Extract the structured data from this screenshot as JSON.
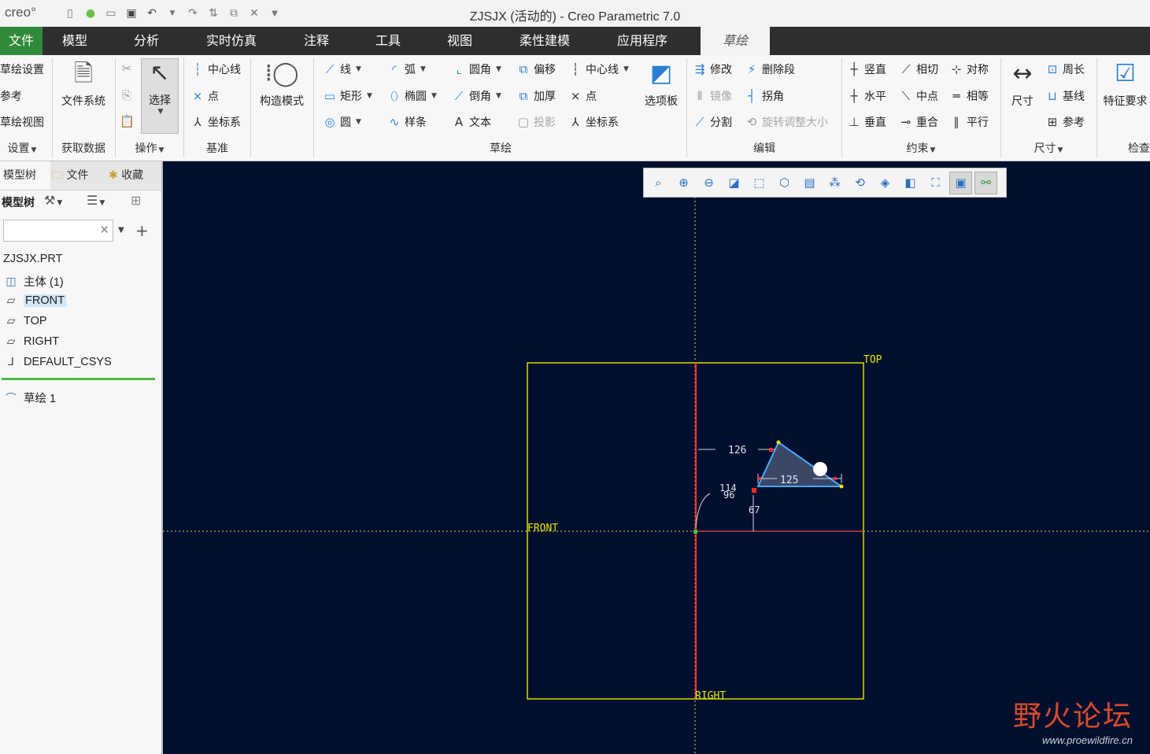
{
  "app": {
    "logo": "creo°",
    "window_title": "ZJSJX (活动的) - Creo Parametric 7.0"
  },
  "tabs": [
    "文件",
    "模型",
    "分析",
    "实时仿真",
    "注释",
    "工具",
    "视图",
    "柔性建模",
    "应用程序",
    "草绘"
  ],
  "ribbon": {
    "setup": {
      "items": [
        "草绘设置",
        "参考",
        "草绘视图"
      ],
      "group": "设置"
    },
    "get_data": {
      "button": "文件系统",
      "group": "获取数据"
    },
    "operations": {
      "button": "选择",
      "group": "操作"
    },
    "datum": {
      "items": [
        "中心线",
        "点",
        "坐标系"
      ],
      "group": "基准"
    },
    "construction": {
      "button": "构造模式"
    },
    "sketch": {
      "col1": [
        "线",
        "矩形",
        "圆"
      ],
      "col2": [
        "弧",
        "椭圆",
        "样条"
      ],
      "col3": [
        "圆角",
        "倒角",
        "文本"
      ],
      "col4": [
        "偏移",
        "加厚",
        "投影"
      ],
      "col5": [
        "中心线",
        "点",
        "坐标系"
      ],
      "palette": "选项板",
      "group": "草绘"
    },
    "edit": {
      "items": [
        "修改",
        "删除段",
        "镜像",
        "拐角",
        "分割",
        "旋转调整大小"
      ],
      "group": "编辑"
    },
    "constrain": {
      "col1": [
        "竖直",
        "水平",
        "垂直"
      ],
      "col2": [
        "相切",
        "中点",
        "重合"
      ],
      "col3": [
        "对称",
        "相等",
        "平行"
      ],
      "group": "约束"
    },
    "dimension": {
      "button": "尺寸",
      "items": [
        "周长",
        "基线",
        "参考"
      ],
      "group": "尺寸"
    },
    "inspect": {
      "button": "特征要求",
      "group": "检查"
    }
  },
  "left_panel": {
    "tabs": [
      "模型树",
      "文件",
      "收藏"
    ],
    "toolbar_label": "模型树",
    "search_placeholder": "",
    "tree": {
      "root": "ZJSJX.PRT",
      "body": "主体 (1)",
      "front": "FRONT",
      "top": "TOP",
      "right": "RIGHT",
      "csys": "DEFAULT_CSYS",
      "sketch": "草绘 1"
    }
  },
  "canvas": {
    "datum_labels": {
      "top": "TOP",
      "front": "FRONT",
      "right": "RIGHT"
    },
    "dims": {
      "d126": "126",
      "d125": "125",
      "d114": "114",
      "d96": "96",
      "d67": "67"
    }
  },
  "watermark": {
    "title": "野火论坛",
    "url": "www.proewildfire.cn"
  }
}
